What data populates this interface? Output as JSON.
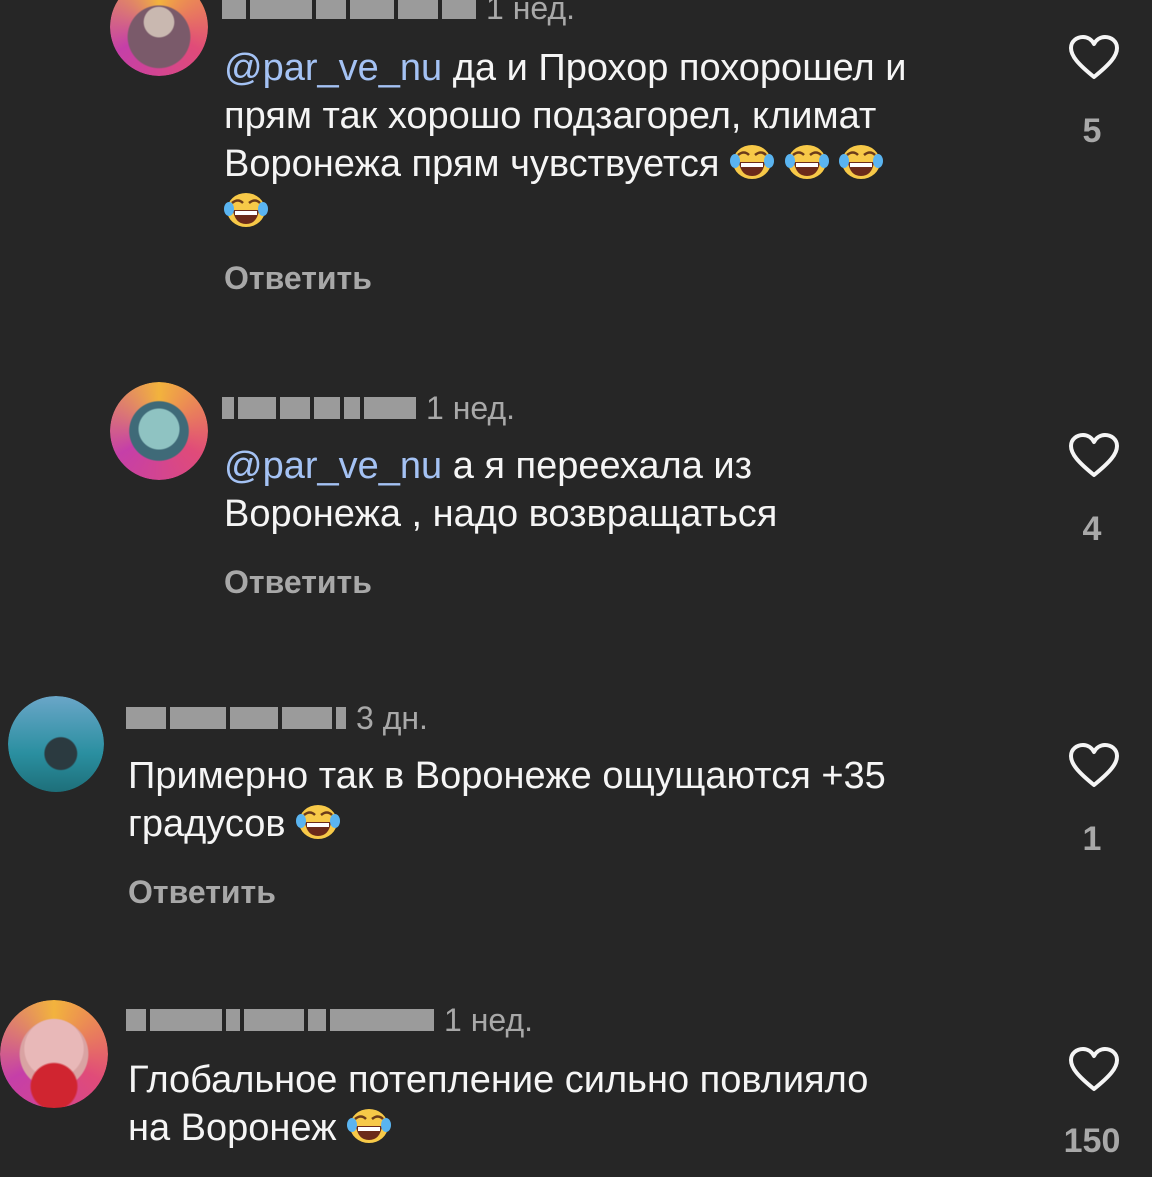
{
  "comments": [
    {
      "time": "1 нед.",
      "mention": "@par_ve_nu",
      "lines": [
        " да и Прохор похорошел и",
        "прям так хорошо подзагорел, климат",
        "Воронежа прям чувствуется "
      ],
      "reply": "Ответить",
      "likes": "5"
    },
    {
      "time": "1 нед.",
      "mention": "@par_ve_nu",
      "lines": [
        " а я переехала из",
        "Воронежа , надо возвращаться"
      ],
      "reply": "Ответить",
      "likes": "4"
    },
    {
      "time": "3 дн.",
      "lines": [
        "Примерно так в Воронеже ощущаются +35",
        "градусов "
      ],
      "reply": "Ответить",
      "likes": "1"
    },
    {
      "time": "1 нед.",
      "lines": [
        "Глобальное потепление сильно повлияло",
        "на Воронеж "
      ],
      "likes": "150"
    }
  ],
  "icons": {
    "like": "heart-outline-icon",
    "emoji": "face-with-tears-of-joy"
  },
  "colors": {
    "background": "#262626",
    "mention": "#a4c2f4",
    "secondary": "#a8a8a8"
  }
}
